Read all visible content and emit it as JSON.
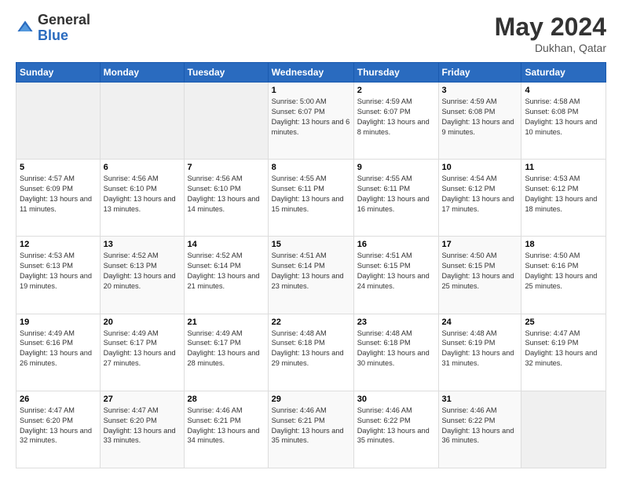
{
  "header": {
    "logo": {
      "general": "General",
      "blue": "Blue"
    },
    "title": "May 2024",
    "subtitle": "Dukhan, Qatar"
  },
  "calendar": {
    "headers": [
      "Sunday",
      "Monday",
      "Tuesday",
      "Wednesday",
      "Thursday",
      "Friday",
      "Saturday"
    ],
    "weeks": [
      [
        {
          "day": "",
          "info": ""
        },
        {
          "day": "",
          "info": ""
        },
        {
          "day": "",
          "info": ""
        },
        {
          "day": "1",
          "info": "Sunrise: 5:00 AM\nSunset: 6:07 PM\nDaylight: 13 hours\nand 6 minutes."
        },
        {
          "day": "2",
          "info": "Sunrise: 4:59 AM\nSunset: 6:07 PM\nDaylight: 13 hours\nand 8 minutes."
        },
        {
          "day": "3",
          "info": "Sunrise: 4:59 AM\nSunset: 6:08 PM\nDaylight: 13 hours\nand 9 minutes."
        },
        {
          "day": "4",
          "info": "Sunrise: 4:58 AM\nSunset: 6:08 PM\nDaylight: 13 hours\nand 10 minutes."
        }
      ],
      [
        {
          "day": "5",
          "info": "Sunrise: 4:57 AM\nSunset: 6:09 PM\nDaylight: 13 hours\nand 11 minutes."
        },
        {
          "day": "6",
          "info": "Sunrise: 4:56 AM\nSunset: 6:10 PM\nDaylight: 13 hours\nand 13 minutes."
        },
        {
          "day": "7",
          "info": "Sunrise: 4:56 AM\nSunset: 6:10 PM\nDaylight: 13 hours\nand 14 minutes."
        },
        {
          "day": "8",
          "info": "Sunrise: 4:55 AM\nSunset: 6:11 PM\nDaylight: 13 hours\nand 15 minutes."
        },
        {
          "day": "9",
          "info": "Sunrise: 4:55 AM\nSunset: 6:11 PM\nDaylight: 13 hours\nand 16 minutes."
        },
        {
          "day": "10",
          "info": "Sunrise: 4:54 AM\nSunset: 6:12 PM\nDaylight: 13 hours\nand 17 minutes."
        },
        {
          "day": "11",
          "info": "Sunrise: 4:53 AM\nSunset: 6:12 PM\nDaylight: 13 hours\nand 18 minutes."
        }
      ],
      [
        {
          "day": "12",
          "info": "Sunrise: 4:53 AM\nSunset: 6:13 PM\nDaylight: 13 hours\nand 19 minutes."
        },
        {
          "day": "13",
          "info": "Sunrise: 4:52 AM\nSunset: 6:13 PM\nDaylight: 13 hours\nand 20 minutes."
        },
        {
          "day": "14",
          "info": "Sunrise: 4:52 AM\nSunset: 6:14 PM\nDaylight: 13 hours\nand 21 minutes."
        },
        {
          "day": "15",
          "info": "Sunrise: 4:51 AM\nSunset: 6:14 PM\nDaylight: 13 hours\nand 23 minutes."
        },
        {
          "day": "16",
          "info": "Sunrise: 4:51 AM\nSunset: 6:15 PM\nDaylight: 13 hours\nand 24 minutes."
        },
        {
          "day": "17",
          "info": "Sunrise: 4:50 AM\nSunset: 6:15 PM\nDaylight: 13 hours\nand 25 minutes."
        },
        {
          "day": "18",
          "info": "Sunrise: 4:50 AM\nSunset: 6:16 PM\nDaylight: 13 hours\nand 25 minutes."
        }
      ],
      [
        {
          "day": "19",
          "info": "Sunrise: 4:49 AM\nSunset: 6:16 PM\nDaylight: 13 hours\nand 26 minutes."
        },
        {
          "day": "20",
          "info": "Sunrise: 4:49 AM\nSunset: 6:17 PM\nDaylight: 13 hours\nand 27 minutes."
        },
        {
          "day": "21",
          "info": "Sunrise: 4:49 AM\nSunset: 6:17 PM\nDaylight: 13 hours\nand 28 minutes."
        },
        {
          "day": "22",
          "info": "Sunrise: 4:48 AM\nSunset: 6:18 PM\nDaylight: 13 hours\nand 29 minutes."
        },
        {
          "day": "23",
          "info": "Sunrise: 4:48 AM\nSunset: 6:18 PM\nDaylight: 13 hours\nand 30 minutes."
        },
        {
          "day": "24",
          "info": "Sunrise: 4:48 AM\nSunset: 6:19 PM\nDaylight: 13 hours\nand 31 minutes."
        },
        {
          "day": "25",
          "info": "Sunrise: 4:47 AM\nSunset: 6:19 PM\nDaylight: 13 hours\nand 32 minutes."
        }
      ],
      [
        {
          "day": "26",
          "info": "Sunrise: 4:47 AM\nSunset: 6:20 PM\nDaylight: 13 hours\nand 32 minutes."
        },
        {
          "day": "27",
          "info": "Sunrise: 4:47 AM\nSunset: 6:20 PM\nDaylight: 13 hours\nand 33 minutes."
        },
        {
          "day": "28",
          "info": "Sunrise: 4:46 AM\nSunset: 6:21 PM\nDaylight: 13 hours\nand 34 minutes."
        },
        {
          "day": "29",
          "info": "Sunrise: 4:46 AM\nSunset: 6:21 PM\nDaylight: 13 hours\nand 35 minutes."
        },
        {
          "day": "30",
          "info": "Sunrise: 4:46 AM\nSunset: 6:22 PM\nDaylight: 13 hours\nand 35 minutes."
        },
        {
          "day": "31",
          "info": "Sunrise: 4:46 AM\nSunset: 6:22 PM\nDaylight: 13 hours\nand 36 minutes."
        },
        {
          "day": "",
          "info": ""
        }
      ]
    ]
  }
}
